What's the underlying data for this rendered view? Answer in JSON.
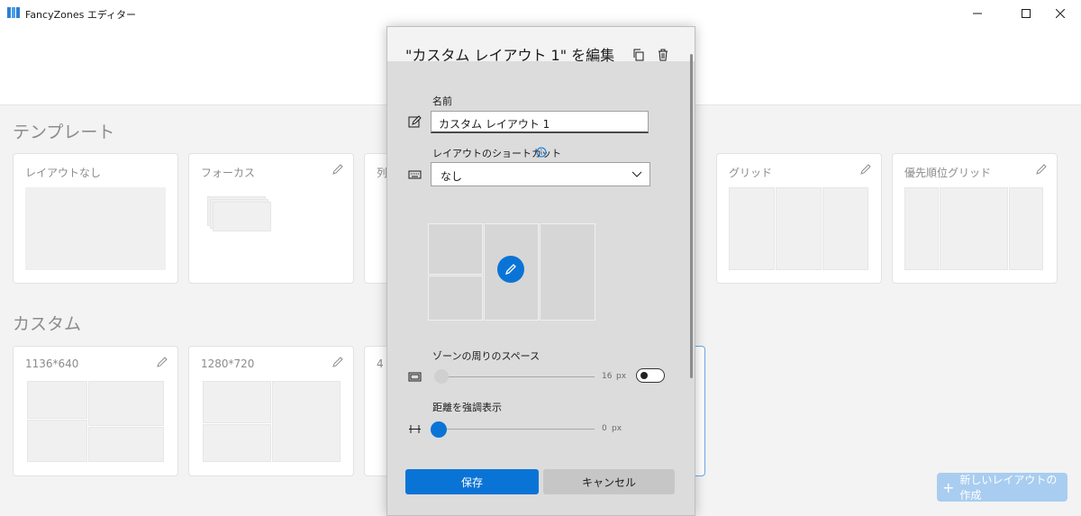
{
  "window": {
    "title": "FancyZones エディター"
  },
  "sections": {
    "templates": "テンプレート",
    "custom": "カスタム"
  },
  "templates": [
    {
      "name": "レイアウトなし"
    },
    {
      "name": "フォーカス"
    },
    {
      "name": "列"
    },
    {
      "name": "グリッド"
    },
    {
      "name": "優先順位グリッド"
    }
  ],
  "custom": [
    {
      "name": "1136*640"
    },
    {
      "name": "1280*720"
    },
    {
      "name": "4"
    }
  ],
  "new_layout_button": "新しいレイアウトの作成",
  "dialog": {
    "title": "\"カスタム レイアウト 1\" を編集",
    "name_label": "名前",
    "name_value": "カスタム レイアウト 1",
    "shortcut_label": "レイアウトのショートカット",
    "shortcut_value": "なし",
    "spacing_label": "ゾーンの周りのスペース",
    "spacing_value": "16",
    "spacing_unit": "px",
    "spacing_enabled": false,
    "highlight_label": "距離を強調表示",
    "highlight_value": "0",
    "highlight_unit": "px",
    "save_button": "保存",
    "cancel_button": "キャンセル"
  },
  "colors": {
    "accent": "#0a74d6",
    "new_button": "#a8cdf0"
  }
}
